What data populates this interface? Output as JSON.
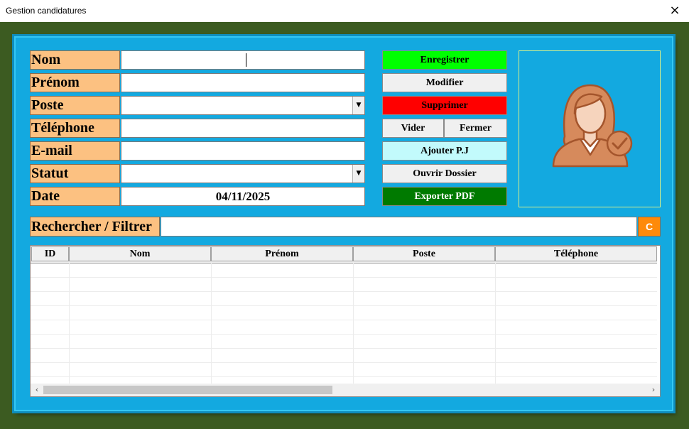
{
  "window": {
    "title": "Gestion candidatures",
    "close_icon": "×"
  },
  "form": {
    "fields": [
      {
        "label": "Nom",
        "value": ""
      },
      {
        "label": "Prénom",
        "value": ""
      },
      {
        "label": "Poste",
        "value": ""
      },
      {
        "label": "Téléphone",
        "value": ""
      },
      {
        "label": "E-mail",
        "value": ""
      },
      {
        "label": "Statut",
        "value": ""
      },
      {
        "label": "Date",
        "value": "04/11/2025"
      }
    ],
    "dropdown_icon": "▼"
  },
  "buttons": {
    "enregistrer": "Enregistrer",
    "modifier": "Modifier",
    "supprimer": "Supprimer",
    "vider": "Vider",
    "fermer": "Fermer",
    "ajouter_pj": "Ajouter P.J",
    "ouvrir_dossier": "Ouvrir Dossier",
    "exporter_pdf": "Exporter PDF"
  },
  "search": {
    "label": "Rechercher / Filtrer",
    "value": "",
    "clear_label": "C"
  },
  "table": {
    "columns": [
      "ID",
      "Nom",
      "Prénom",
      "Poste",
      "Téléphone"
    ],
    "rows": []
  },
  "scrollbar": {
    "left_icon": "‹",
    "right_icon": "›"
  },
  "colors": {
    "panel": "#13a9e0",
    "label_bg": "#fcc181",
    "enregistrer": "#00ff00",
    "supprimer": "#ff0000",
    "ajouter_pj": "#c2fafc",
    "exporter_pdf": "#007a00",
    "clear_button": "#fe8a0a",
    "avatar": "#d68a5c"
  },
  "avatar": {
    "icon": "user-verified-icon"
  }
}
